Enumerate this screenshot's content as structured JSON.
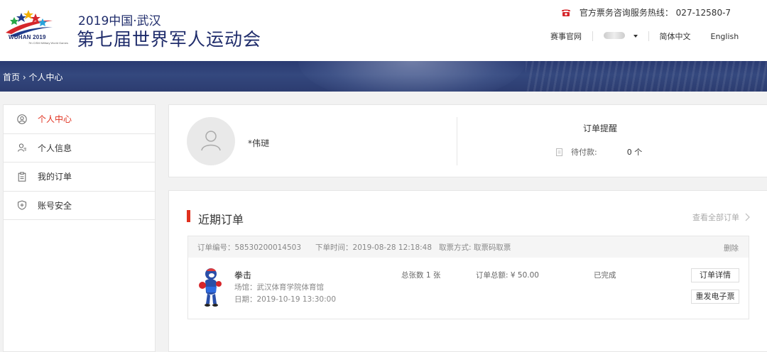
{
  "header": {
    "title_line1": "2019中国·武汉",
    "title_line2": "第七届世界军人运动会",
    "logo_text": "WUHAN 2019",
    "logo_sub": "7th CISM Military World Games",
    "hotline_label": "官方票务咨询服务热线：",
    "hotline_number": "027-12580-7",
    "nav_official": "赛事官网",
    "nav_lang_cn": "简体中文",
    "nav_lang_en": "English"
  },
  "breadcrumb": {
    "home": "首页",
    "sep": " › ",
    "current": "个人中心"
  },
  "sidebar": {
    "items": [
      {
        "label": "个人中心"
      },
      {
        "label": "个人信息"
      },
      {
        "label": "我的订单"
      },
      {
        "label": "账号安全"
      }
    ]
  },
  "profile": {
    "username": "*伟琎",
    "reminder_title": "订单提醒",
    "pending_label": "待付款:",
    "pending_count": "0 个"
  },
  "orders": {
    "section_title": "近期订单",
    "view_all": "查看全部订单",
    "list": [
      {
        "order_no": "订单编号：58530200014503",
        "order_time": "下单时间：2019-08-28 12:18:48",
        "pickup": "取票方式: 取票码取票",
        "delete": "删除",
        "event": "拳击",
        "venue": "场馆：武汉体育学院体育馆",
        "date": "日期：2019-10-19 13:30:00",
        "qty": "总张数 1 张",
        "total": "订单总额: ¥ 50.00",
        "status": "已完成",
        "btn_detail": "订单详情",
        "btn_resend": "重发电子票"
      }
    ]
  },
  "colors": {
    "accent": "#e0301e",
    "brand_blue": "#1f2c6b",
    "banner": "#2a3a72"
  }
}
